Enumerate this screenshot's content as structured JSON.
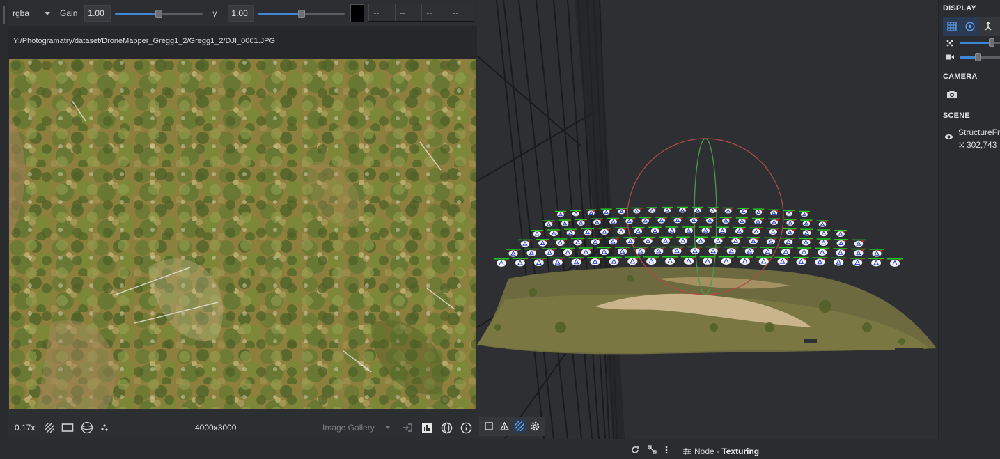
{
  "viewer2d": {
    "channel": "rgba",
    "gain_label": "Gain",
    "gain_value": "1.00",
    "gamma_label": "γ",
    "gamma_value": "1.00",
    "pixel_values": [
      "--",
      "--",
      "--",
      "--"
    ],
    "image_path": "Y:/Photogramatry/dataset/DroneMapper_Gregg1_2/Gregg1_2/DJI_0001.JPG",
    "zoom": "0.17x",
    "resolution": "4000x3000",
    "gallery_label": "Image Gallery"
  },
  "panel": {
    "display_title": "DISPLAY",
    "camera_title": "CAMERA",
    "scene_title": "SCENE",
    "scene_item_name": "StructureFr",
    "scene_item_count": "302,743"
  },
  "bottombar": {
    "node_prefix": "Node - ",
    "node_name": "Texturing"
  },
  "colors": {
    "accent": "#3e86d6",
    "background": "#2b2c2f"
  }
}
